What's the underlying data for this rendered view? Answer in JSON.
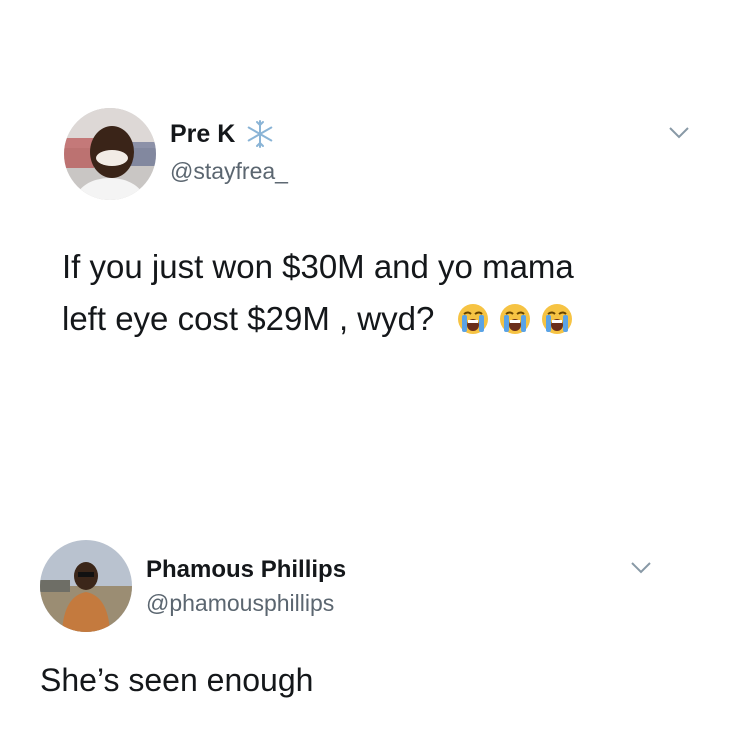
{
  "tweets": [
    {
      "display_name": "Pre K",
      "handle": "@stayfrea_",
      "badge_icon": "snowflake-icon",
      "menu_icon": "chevron-down-icon",
      "text_lines": [
        "If you just won $30M and yo mama",
        "left eye cost $29M , wyd?"
      ],
      "emojis": [
        "loudly-crying-face-icon",
        "loudly-crying-face-icon",
        "loudly-crying-face-icon"
      ]
    },
    {
      "display_name": "Phamous Phillips",
      "handle": "@phamousphillips",
      "menu_icon": "chevron-down-icon",
      "text_lines": [
        "She’s seen enough"
      ]
    }
  ],
  "colors": {
    "text": "#14171a",
    "secondary": "#5b6670",
    "background": "#ffffff",
    "snowflake": "#8ab4d6",
    "emoji_face": "#f6c343",
    "emoji_tears": "#5aa3e6"
  }
}
